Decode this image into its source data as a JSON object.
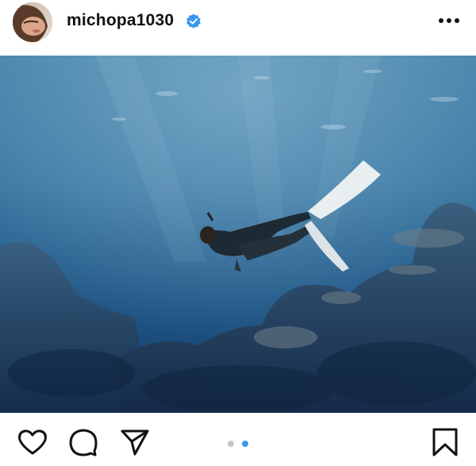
{
  "post": {
    "username": "michopa1030",
    "verified": true,
    "accent_color": "#3897f0",
    "carousel": {
      "total": 2,
      "current": 2
    }
  },
  "icons": {
    "avatar": "profile-photo",
    "more": "more-horizontal-icon",
    "verified": "verified-badge-icon",
    "like": "heart-icon",
    "comment": "comment-bubble-icon",
    "share": "paper-plane-icon",
    "save": "bookmark-icon"
  }
}
